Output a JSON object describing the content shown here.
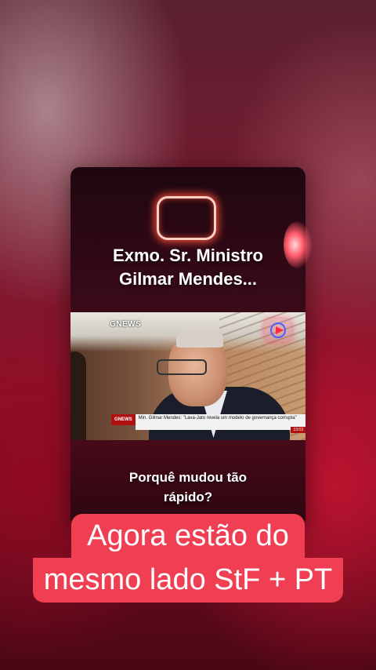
{
  "card": {
    "headline_line1": "Exmo. Sr. Ministro",
    "headline_line2": "Gilmar Mendes...",
    "question_line1": "Porquê mudou tão",
    "question_line2": "rápido?"
  },
  "video": {
    "channel_logo": "GNEWS",
    "lower_third_tag": "GNEWS",
    "lower_third_text": "Min. Gilmar Mendes: \"Lava-Jato revela um modelo de governança corrupta\"",
    "time": "13:03",
    "play_icon": "play-icon"
  },
  "banner": {
    "line1": "Agora estão do",
    "line2": "mesmo lado StF + PT"
  },
  "colors": {
    "banner_bg": "#f03e52",
    "card_bg": "#3a0a18"
  }
}
